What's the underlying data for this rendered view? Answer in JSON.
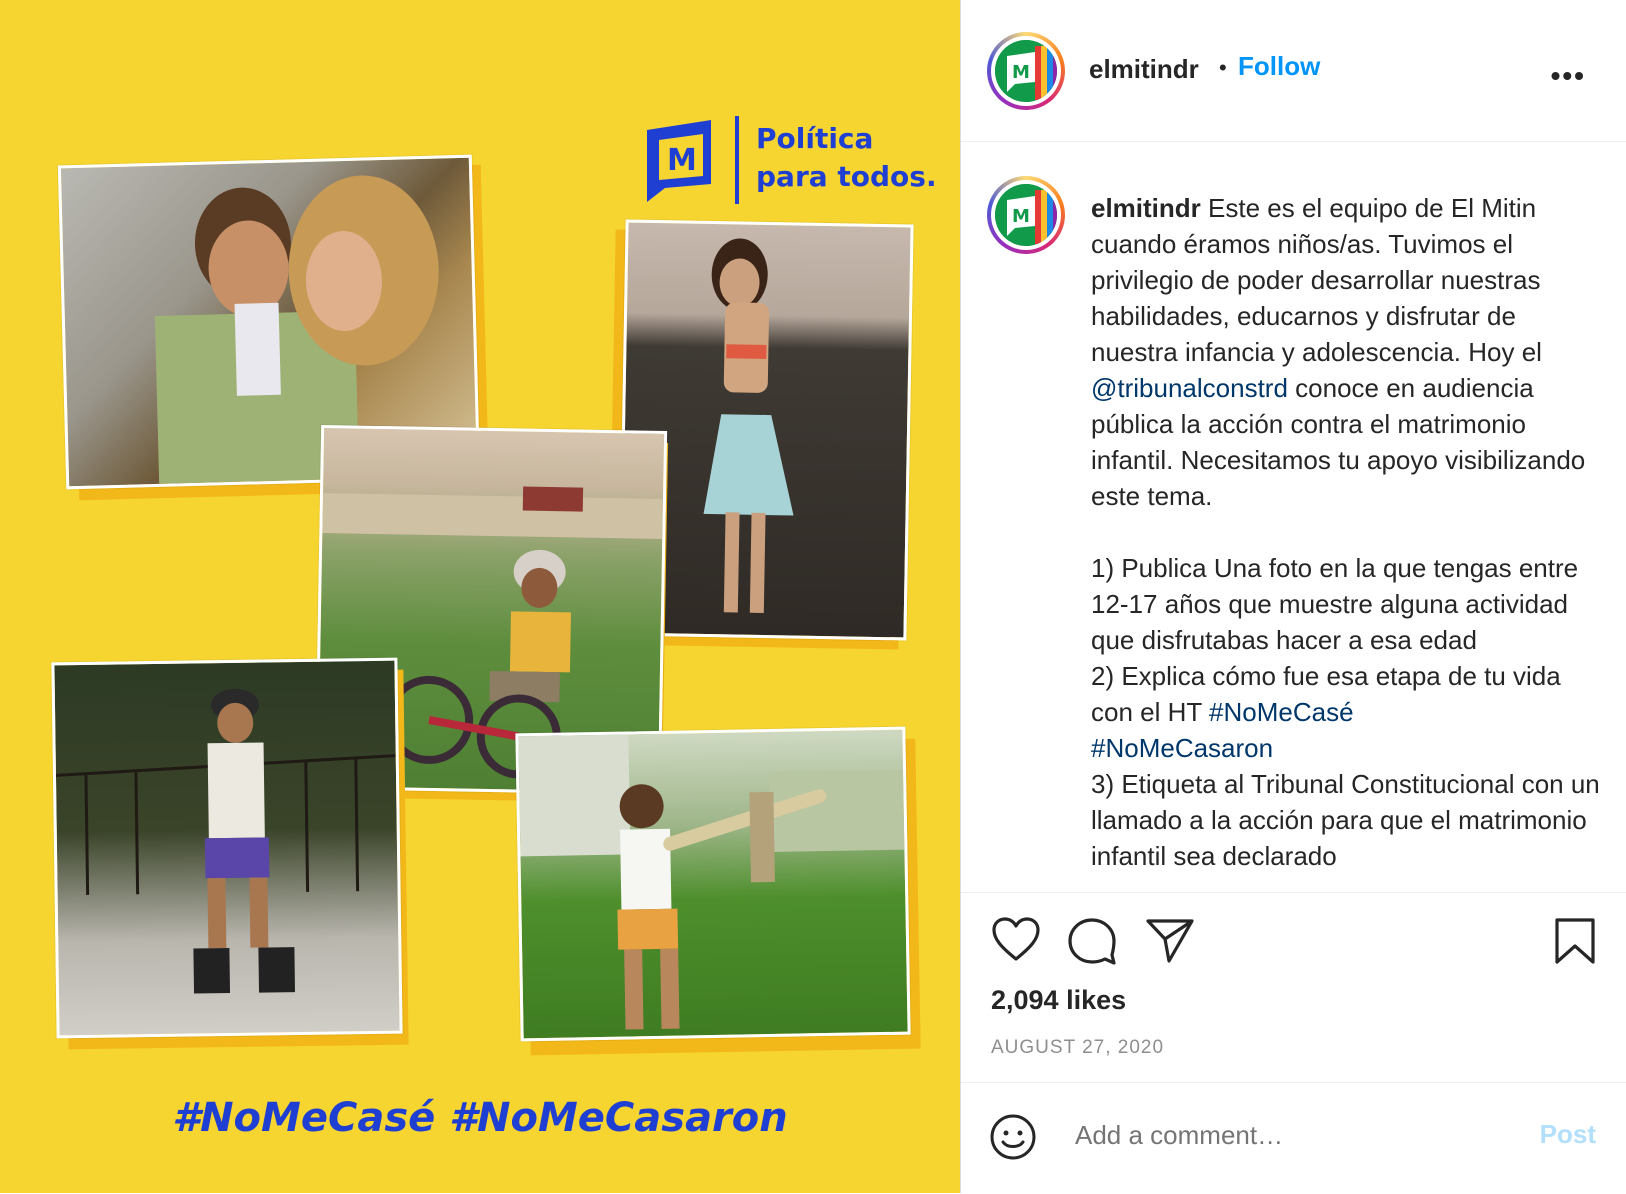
{
  "media": {
    "brand_line1": "Política",
    "brand_line2": "para todos.",
    "hashtags": "#NoMeCasé #NoMeCasaron",
    "colors": {
      "background": "#f7d531",
      "brand_blue": "#1f3fd3"
    }
  },
  "header": {
    "username": "elmitindr",
    "separator": "•",
    "follow_label": "Follow",
    "more_label": "•••"
  },
  "caption": {
    "username": "elmitindr",
    "text_1": " Este es el equipo de El Mitin cuando éramos niños/as. Tuvimos el privilegio de poder desarrollar nuestras habilidades, educarnos y disfrutar de nuestra infancia y adolescencia. Hoy el ",
    "mention": "@tribunalconstrd",
    "text_2": " conoce en audiencia pública la acción contra el matrimonio infantil. Necesitamos tu apoyo visibilizando este tema.\n\n1) Publica Una foto en la que tengas entre 12-17 años que muestre alguna actividad que disfrutabas hacer a esa edad\n2) Explica cómo fue esa etapa de tu vida con el HT ",
    "tag1": "#NoMeCasé",
    "text_3": "\n",
    "tag2": "#NoMeCasaron",
    "text_4": "\n3) Etiqueta al Tribunal Constitucional con un llamado a la acción para que el matrimonio infantil sea declarado"
  },
  "actions": {
    "likes": "2,094 likes",
    "date": "AUGUST 27, 2020"
  },
  "comment": {
    "placeholder": "Add a comment…",
    "post_label": "Post"
  }
}
